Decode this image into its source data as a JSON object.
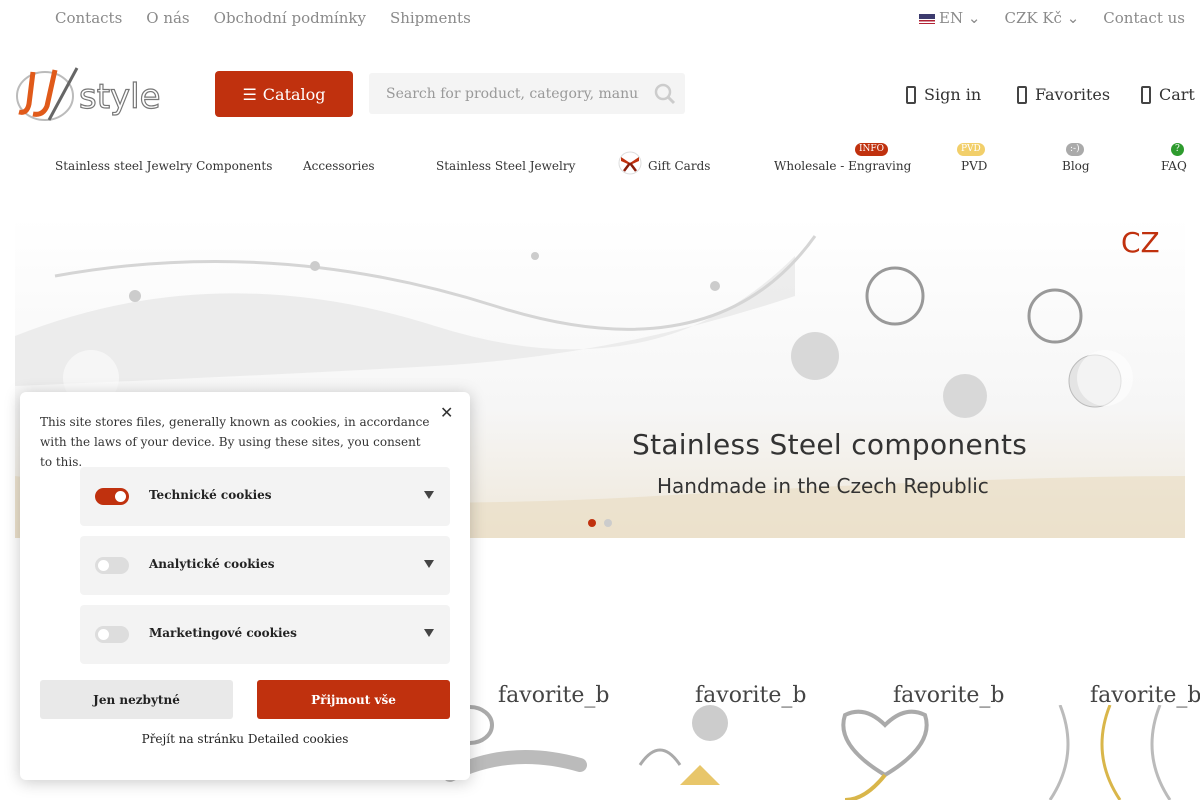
{
  "topbar": {
    "links": [
      "Contacts",
      "O nás",
      "Obchodní podmínky",
      "Shipments"
    ],
    "language": "EN",
    "currency": "CZK Kč",
    "contact": "Contact us"
  },
  "header": {
    "catalog_label": "Catalog",
    "search_placeholder": "Search for product, category, manufacturer...",
    "sign_in": "Sign in",
    "favorites": "Favorites",
    "cart": "Cart"
  },
  "nav": {
    "items": [
      "Stainless steel Jewelry Components",
      "Accessories",
      "Stainless Steel Jewelry",
      "Gift Cards",
      "Wholesale - Engraving",
      "PVD",
      "Blog",
      "FAQ"
    ],
    "badges": {
      "wholesale": "INFO",
      "pvd": "PVD",
      "blog": ":-)",
      "faq": "?"
    }
  },
  "banner": {
    "title": "Stainless Steel components",
    "subtitle": "Handmade in the Czech Republic",
    "mark": "CZ",
    "slides": 2,
    "active_slide": 1
  },
  "products": {
    "labels": [
      "favorite_b",
      "favorite_b",
      "favorite_b",
      "favorite_b"
    ]
  },
  "cookie": {
    "message": "This site stores files, generally known as cookies, in accordance with the laws of your device. By using these sites, you consent to this.",
    "categories": [
      {
        "label": "Technické cookies",
        "enabled": true
      },
      {
        "label": "Analytické cookies",
        "enabled": false
      },
      {
        "label": "Marketingové cookies",
        "enabled": false
      }
    ],
    "necessary_only": "Jen nezbytné",
    "accept_all": "Přijmout vše",
    "details_link": "Přejít na stránku Detailed cookies"
  },
  "colors": {
    "accent": "#c0310e"
  }
}
